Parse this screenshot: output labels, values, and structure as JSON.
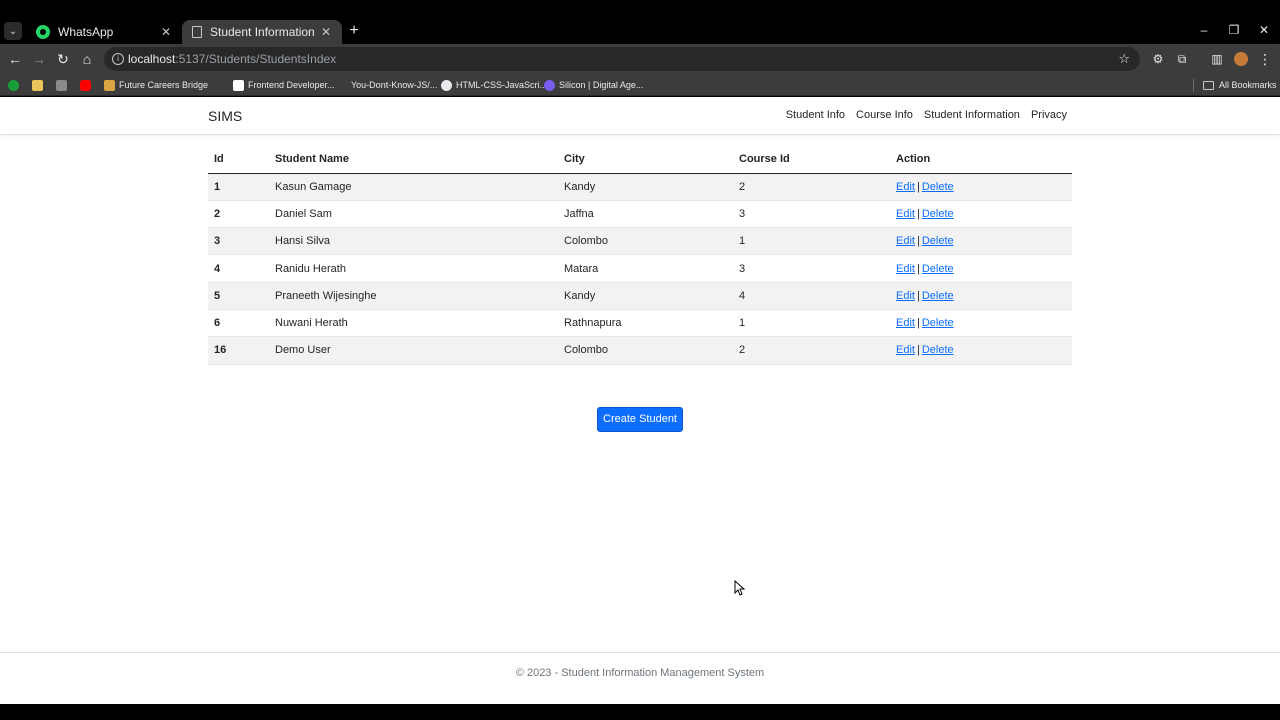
{
  "browser": {
    "tabs": [
      {
        "title": "WhatsApp",
        "icon": "whatsapp-icon"
      },
      {
        "title": "Student Information - SIMS",
        "icon": "document-icon"
      }
    ],
    "url_host": "localhost",
    "url_rest": ":5137/Students/StudentsIndex",
    "bookmarks": [
      {
        "label": "",
        "icon": "leaf-icon",
        "color": "#1a9e3a"
      },
      {
        "label": "",
        "icon": "bookmark-app-icon",
        "color": "#e8c45a"
      },
      {
        "label": "",
        "icon": "grid-icon",
        "color": "#8a8a8a"
      },
      {
        "label": "",
        "icon": "youtube-icon",
        "color": "#ff0000"
      },
      {
        "label": "Future Careers Bridge",
        "icon": "fcb-icon",
        "color": "#d9a441"
      },
      {
        "label": "Frontend Developer...",
        "icon": "f-icon",
        "color": "#ffffff"
      },
      {
        "label": "You-Dont-Know-JS/...",
        "icon": "blank-icon",
        "color": "#3c3c3c"
      },
      {
        "label": "HTML-CSS-JavaScri...",
        "icon": "github-icon",
        "color": "#e8eaed"
      },
      {
        "label": "Silicon | Digital Age...",
        "icon": "silicon-icon",
        "color": "#7b5cf0"
      }
    ],
    "all_bookmarks": "All Bookmarks"
  },
  "nav": {
    "brand": "SIMS",
    "links": [
      "Student Info",
      "Course Info",
      "Student Information",
      "Privacy"
    ]
  },
  "table": {
    "headers": [
      "Id",
      "Student Name",
      "City",
      "Course Id",
      "Action"
    ],
    "rows": [
      {
        "id": "1",
        "name": "Kasun Gamage",
        "city": "Kandy",
        "course": "2"
      },
      {
        "id": "2",
        "name": "Daniel Sam",
        "city": "Jaffna",
        "course": "3"
      },
      {
        "id": "3",
        "name": "Hansi Silva",
        "city": "Colombo",
        "course": "1"
      },
      {
        "id": "4",
        "name": "Ranidu Herath",
        "city": "Matara",
        "course": "3"
      },
      {
        "id": "5",
        "name": "Praneeth Wijesinghe",
        "city": "Kandy",
        "course": "4"
      },
      {
        "id": "6",
        "name": "Nuwani Herath",
        "city": "Rathnapura",
        "course": "1"
      },
      {
        "id": "16",
        "name": "Demo User",
        "city": "Colombo",
        "course": "2"
      }
    ],
    "edit_label": "Edit",
    "separator": "|",
    "delete_label": "Delete"
  },
  "create_button": "Create Student",
  "footer": "© 2023 - Student Information Management System",
  "colors": {
    "primary": "#0d6efd",
    "stripe": "#f2f2f2",
    "chrome_dark": "#3c3c3c"
  }
}
